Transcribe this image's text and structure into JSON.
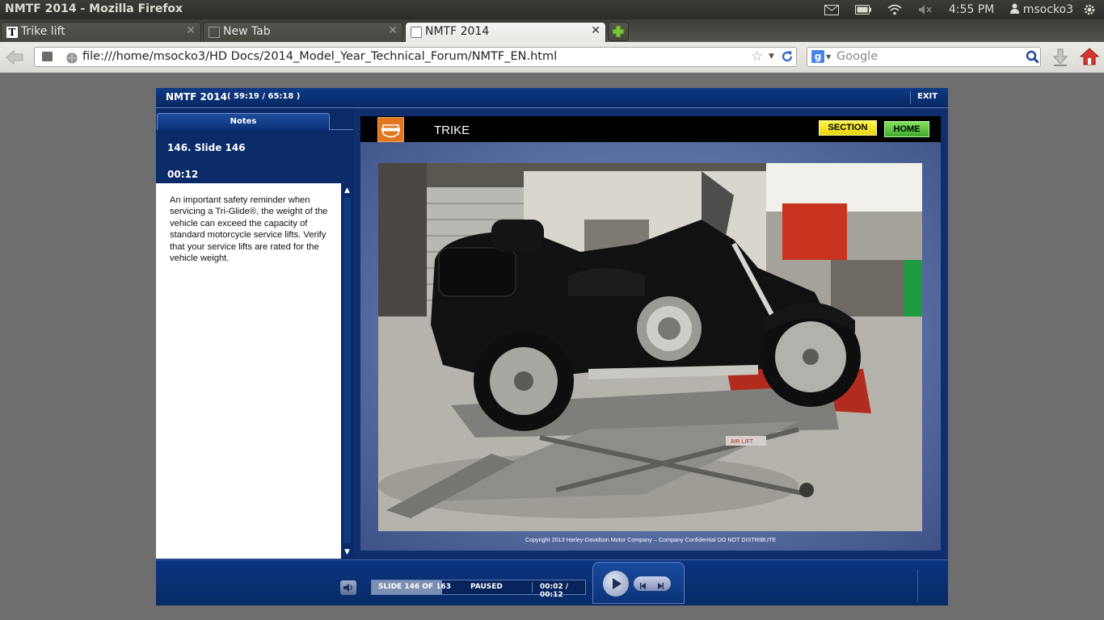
{
  "os": {
    "window_title": "NMTF 2014 - Mozilla Firefox",
    "clock": "4:55 PM",
    "user": "msocko3",
    "indicator_icons": [
      "mail-icon",
      "battery-icon",
      "wifi-icon",
      "volume-muted-icon",
      "user-icon",
      "gear-icon"
    ]
  },
  "browser": {
    "tabs": [
      {
        "label": "Trike lift",
        "favicon": "T",
        "active": false
      },
      {
        "label": "New Tab",
        "active": false
      },
      {
        "label": "NMTF 2014",
        "active": true
      }
    ],
    "tab_close_glyph": "✕",
    "url": "file:///home/msocko3/HD Docs/2014_Model_Year_Technical_Forum/NMTF_EN.html",
    "search_engine": "Google",
    "search_placeholder": "Google"
  },
  "player": {
    "title": "NMTF 2014",
    "time": "( 59:19 / 65:18 )",
    "exit_label": "EXIT",
    "sidebar": {
      "tab_label": "Notes",
      "slide_name": "146. Slide 146",
      "slide_duration": "00:12",
      "notes_text": "An important safety reminder when servicing a Tri-Glide®,  the weight of the vehicle can exceed the capacity of standard motorcycle service lifts. Verify that your service lifts are rated for the vehicle weight.",
      "scroll_up": "▲",
      "scroll_down": "▼"
    },
    "slide": {
      "section_title": "TRIKE",
      "section_button": "SECTION",
      "home_button": "HOME",
      "photo_lift_text": "AIR LIFT",
      "copyright": "Copyright 2013 Harley-Davidson Motor Company – Company Confidential DO NOT DISTRIBUTE"
    },
    "controls": {
      "slide_counter": "SLIDE 146 OF 163",
      "progress": 0.33,
      "state": "PAUSED",
      "time": "00:02 / 00:12"
    }
  }
}
